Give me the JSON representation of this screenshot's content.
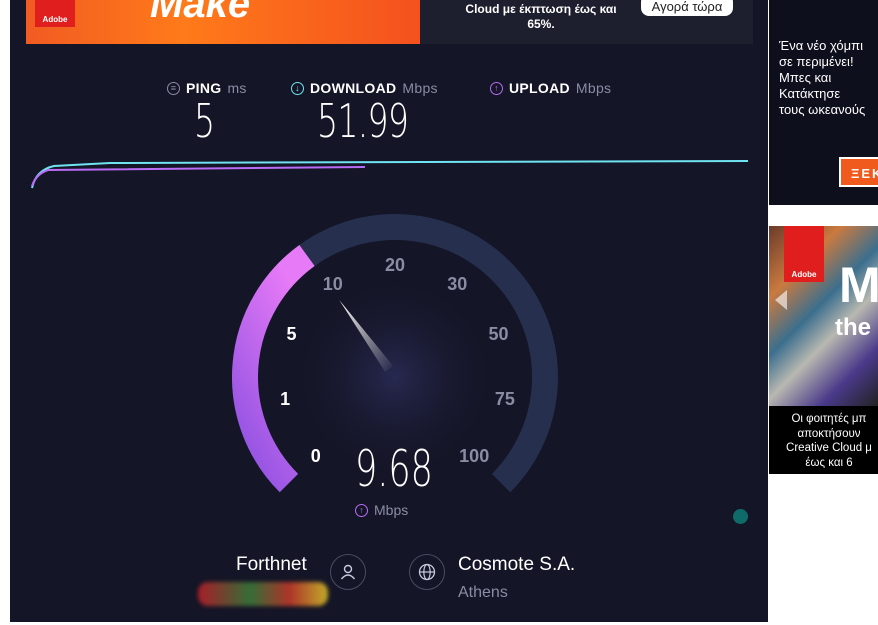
{
  "top_ad": {
    "brand": "Adobe",
    "headline": "Make",
    "text_line1": "Cloud με έκπτωση έως και",
    "text_line2": "65%.",
    "button": "Αγορά τώρα"
  },
  "stats": {
    "ping": {
      "label": "PING",
      "unit": "ms",
      "value": "5",
      "color": "#8a8ca3"
    },
    "download": {
      "label": "DOWNLOAD",
      "unit": "Mbps",
      "value": "51.99",
      "color": "#6fe3f0"
    },
    "upload": {
      "label": "UPLOAD",
      "unit": "Mbps",
      "value": "",
      "color": "#b96cf5"
    }
  },
  "gauge": {
    "labels": [
      "0",
      "1",
      "5",
      "10",
      "20",
      "30",
      "50",
      "75",
      "100"
    ],
    "current_value": 9.68,
    "reading": "9.68",
    "reading_unit": "Mbps",
    "arc_colors": {
      "start": "#8a4fe0",
      "end": "#e77af7",
      "track": "#262f4e"
    }
  },
  "isp": {
    "name": "Forthnet",
    "ip": "",
    "user_icon": "user-icon"
  },
  "server": {
    "name": "Cosmote S.A.",
    "location": "Athens",
    "globe_icon": "globe-icon"
  },
  "right_ad_1": {
    "lines": [
      "Ένα νέο χόμπι",
      "σε περιμένει!",
      "Μπες και",
      "Κατάκτησε",
      "τους ωκεανούς"
    ],
    "button": "ΞΕΚ"
  },
  "right_ad_2": {
    "brand": "Adobe",
    "headline": "M",
    "subhead": "the",
    "lines": [
      "Οι φοιτητές μπ",
      "αποκτήσουν",
      "Creative Cloud μ",
      "έως και 6"
    ]
  }
}
